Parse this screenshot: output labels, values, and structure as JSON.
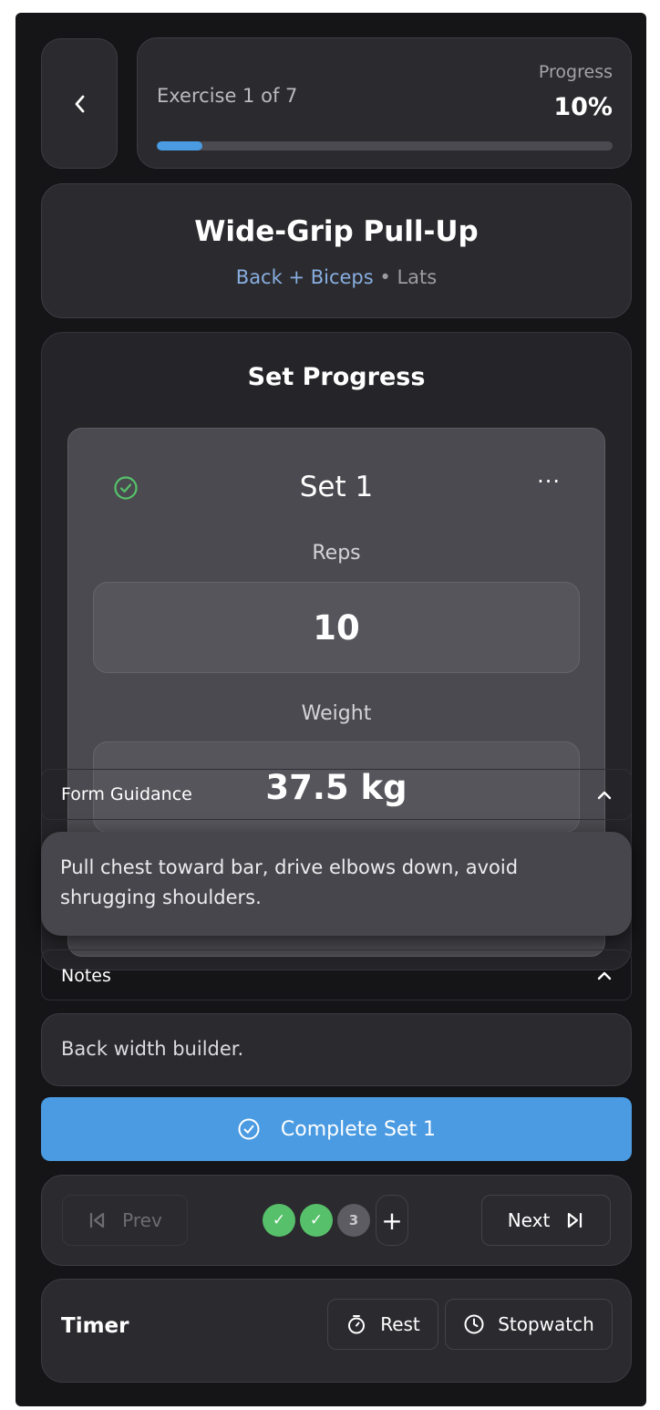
{
  "header": {
    "exercise_counter": "Exercise 1 of 7",
    "progress_label": "Progress",
    "progress_value": "10%",
    "progress_fraction": 0.1
  },
  "exercise": {
    "name": "Wide-Grip Pull-Up",
    "muscle_group": "Back + Biceps",
    "secondary_muscle": "• Lats"
  },
  "set_progress": {
    "title": "Set Progress",
    "current_set": {
      "title": "Set 1",
      "menu": "···",
      "reps_label": "Reps",
      "reps_value": "10",
      "weight_label": "Weight",
      "weight_value": "37.5 kg"
    }
  },
  "form_guidance": {
    "label": "Form Guidance",
    "text": "Pull chest toward bar, drive elbows down, avoid shrugging shoulders."
  },
  "notes": {
    "label": "Notes",
    "text": "Back width builder."
  },
  "complete_button": "Complete Set 1",
  "set_nav": {
    "prev_label": "Prev",
    "next_label": "Next",
    "dots": [
      {
        "label": "✓",
        "state": "done"
      },
      {
        "label": "✓",
        "state": "done"
      },
      {
        "label": "3",
        "state": "pending"
      }
    ],
    "add_label": "+"
  },
  "timer": {
    "label": "Timer",
    "rest_label": "Rest",
    "stopwatch_label": "Stopwatch"
  },
  "colors": {
    "accent": "#4a9be2",
    "success": "#56c16a",
    "background": "#151518",
    "card": "#2b2b2f"
  },
  "icons": [
    "chevron-left-icon",
    "check-circle-icon",
    "more-icon",
    "chevron-up-icon",
    "skip-back-icon",
    "skip-forward-icon",
    "stopwatch-icon",
    "clock-icon"
  ]
}
